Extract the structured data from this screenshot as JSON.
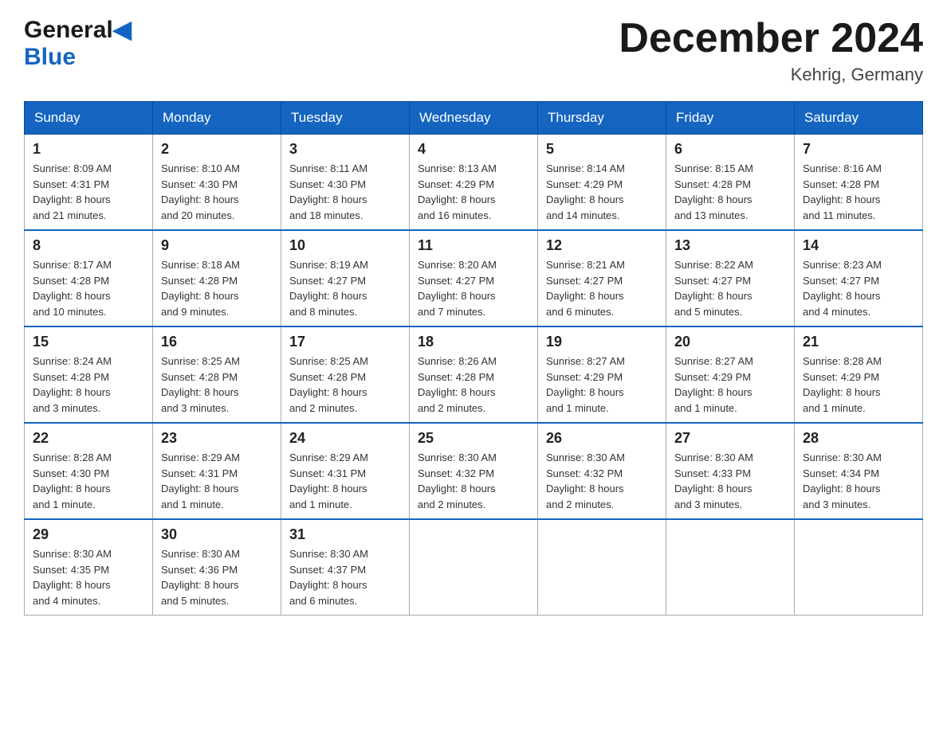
{
  "logo": {
    "general": "General",
    "blue": "Blue"
  },
  "title": "December 2024",
  "location": "Kehrig, Germany",
  "days_of_week": [
    "Sunday",
    "Monday",
    "Tuesday",
    "Wednesday",
    "Thursday",
    "Friday",
    "Saturday"
  ],
  "weeks": [
    [
      {
        "day": "1",
        "sunrise": "8:09 AM",
        "sunset": "4:31 PM",
        "daylight": "8 hours and 21 minutes."
      },
      {
        "day": "2",
        "sunrise": "8:10 AM",
        "sunset": "4:30 PM",
        "daylight": "8 hours and 20 minutes."
      },
      {
        "day": "3",
        "sunrise": "8:11 AM",
        "sunset": "4:30 PM",
        "daylight": "8 hours and 18 minutes."
      },
      {
        "day": "4",
        "sunrise": "8:13 AM",
        "sunset": "4:29 PM",
        "daylight": "8 hours and 16 minutes."
      },
      {
        "day": "5",
        "sunrise": "8:14 AM",
        "sunset": "4:29 PM",
        "daylight": "8 hours and 14 minutes."
      },
      {
        "day": "6",
        "sunrise": "8:15 AM",
        "sunset": "4:28 PM",
        "daylight": "8 hours and 13 minutes."
      },
      {
        "day": "7",
        "sunrise": "8:16 AM",
        "sunset": "4:28 PM",
        "daylight": "8 hours and 11 minutes."
      }
    ],
    [
      {
        "day": "8",
        "sunrise": "8:17 AM",
        "sunset": "4:28 PM",
        "daylight": "8 hours and 10 minutes."
      },
      {
        "day": "9",
        "sunrise": "8:18 AM",
        "sunset": "4:28 PM",
        "daylight": "8 hours and 9 minutes."
      },
      {
        "day": "10",
        "sunrise": "8:19 AM",
        "sunset": "4:27 PM",
        "daylight": "8 hours and 8 minutes."
      },
      {
        "day": "11",
        "sunrise": "8:20 AM",
        "sunset": "4:27 PM",
        "daylight": "8 hours and 7 minutes."
      },
      {
        "day": "12",
        "sunrise": "8:21 AM",
        "sunset": "4:27 PM",
        "daylight": "8 hours and 6 minutes."
      },
      {
        "day": "13",
        "sunrise": "8:22 AM",
        "sunset": "4:27 PM",
        "daylight": "8 hours and 5 minutes."
      },
      {
        "day": "14",
        "sunrise": "8:23 AM",
        "sunset": "4:27 PM",
        "daylight": "8 hours and 4 minutes."
      }
    ],
    [
      {
        "day": "15",
        "sunrise": "8:24 AM",
        "sunset": "4:28 PM",
        "daylight": "8 hours and 3 minutes."
      },
      {
        "day": "16",
        "sunrise": "8:25 AM",
        "sunset": "4:28 PM",
        "daylight": "8 hours and 3 minutes."
      },
      {
        "day": "17",
        "sunrise": "8:25 AM",
        "sunset": "4:28 PM",
        "daylight": "8 hours and 2 minutes."
      },
      {
        "day": "18",
        "sunrise": "8:26 AM",
        "sunset": "4:28 PM",
        "daylight": "8 hours and 2 minutes."
      },
      {
        "day": "19",
        "sunrise": "8:27 AM",
        "sunset": "4:29 PM",
        "daylight": "8 hours and 1 minute."
      },
      {
        "day": "20",
        "sunrise": "8:27 AM",
        "sunset": "4:29 PM",
        "daylight": "8 hours and 1 minute."
      },
      {
        "day": "21",
        "sunrise": "8:28 AM",
        "sunset": "4:29 PM",
        "daylight": "8 hours and 1 minute."
      }
    ],
    [
      {
        "day": "22",
        "sunrise": "8:28 AM",
        "sunset": "4:30 PM",
        "daylight": "8 hours and 1 minute."
      },
      {
        "day": "23",
        "sunrise": "8:29 AM",
        "sunset": "4:31 PM",
        "daylight": "8 hours and 1 minute."
      },
      {
        "day": "24",
        "sunrise": "8:29 AM",
        "sunset": "4:31 PM",
        "daylight": "8 hours and 1 minute."
      },
      {
        "day": "25",
        "sunrise": "8:30 AM",
        "sunset": "4:32 PM",
        "daylight": "8 hours and 2 minutes."
      },
      {
        "day": "26",
        "sunrise": "8:30 AM",
        "sunset": "4:32 PM",
        "daylight": "8 hours and 2 minutes."
      },
      {
        "day": "27",
        "sunrise": "8:30 AM",
        "sunset": "4:33 PM",
        "daylight": "8 hours and 3 minutes."
      },
      {
        "day": "28",
        "sunrise": "8:30 AM",
        "sunset": "4:34 PM",
        "daylight": "8 hours and 3 minutes."
      }
    ],
    [
      {
        "day": "29",
        "sunrise": "8:30 AM",
        "sunset": "4:35 PM",
        "daylight": "8 hours and 4 minutes."
      },
      {
        "day": "30",
        "sunrise": "8:30 AM",
        "sunset": "4:36 PM",
        "daylight": "8 hours and 5 minutes."
      },
      {
        "day": "31",
        "sunrise": "8:30 AM",
        "sunset": "4:37 PM",
        "daylight": "8 hours and 6 minutes."
      },
      null,
      null,
      null,
      null
    ]
  ],
  "labels": {
    "sunrise": "Sunrise:",
    "sunset": "Sunset:",
    "daylight": "Daylight:"
  }
}
